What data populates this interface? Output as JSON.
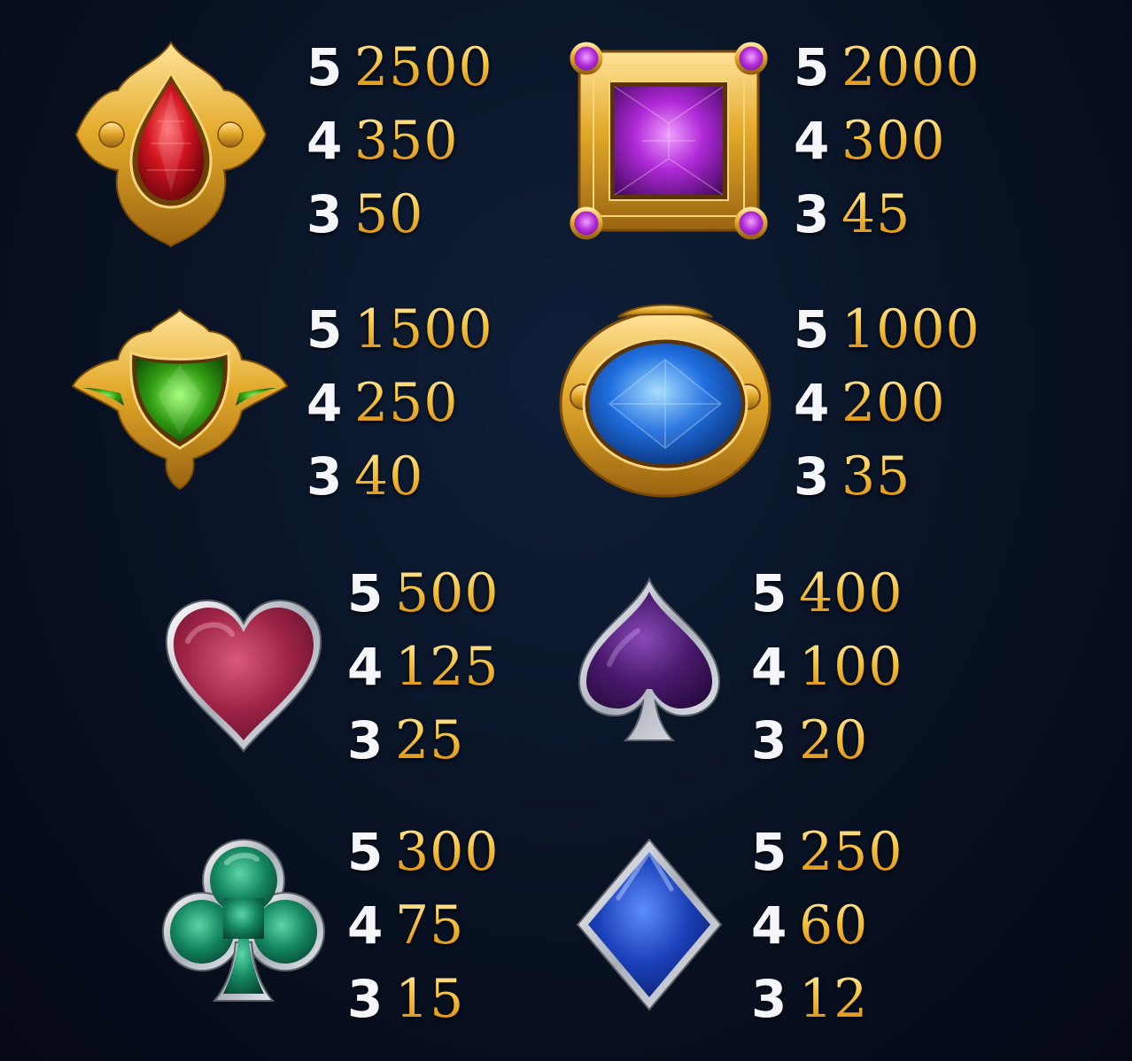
{
  "paytable": {
    "symbols": [
      {
        "name": "red-gem",
        "icon": "red-teardrop-gem-icon",
        "payouts": [
          {
            "count": "5",
            "amount": "2500"
          },
          {
            "count": "4",
            "amount": "350"
          },
          {
            "count": "3",
            "amount": "50"
          }
        ]
      },
      {
        "name": "purple-gem",
        "icon": "purple-square-gem-icon",
        "payouts": [
          {
            "count": "5",
            "amount": "2000"
          },
          {
            "count": "4",
            "amount": "300"
          },
          {
            "count": "3",
            "amount": "45"
          }
        ]
      },
      {
        "name": "green-gem",
        "icon": "green-crest-gem-icon",
        "payouts": [
          {
            "count": "5",
            "amount": "1500"
          },
          {
            "count": "4",
            "amount": "250"
          },
          {
            "count": "3",
            "amount": "40"
          }
        ]
      },
      {
        "name": "blue-gem",
        "icon": "blue-oval-gem-icon",
        "payouts": [
          {
            "count": "5",
            "amount": "1000"
          },
          {
            "count": "4",
            "amount": "200"
          },
          {
            "count": "3",
            "amount": "35"
          }
        ]
      },
      {
        "name": "heart",
        "icon": "heart-icon",
        "payouts": [
          {
            "count": "5",
            "amount": "500"
          },
          {
            "count": "4",
            "amount": "125"
          },
          {
            "count": "3",
            "amount": "25"
          }
        ]
      },
      {
        "name": "spade",
        "icon": "spade-icon",
        "payouts": [
          {
            "count": "5",
            "amount": "400"
          },
          {
            "count": "4",
            "amount": "100"
          },
          {
            "count": "3",
            "amount": "20"
          }
        ]
      },
      {
        "name": "club",
        "icon": "club-icon",
        "payouts": [
          {
            "count": "5",
            "amount": "300"
          },
          {
            "count": "4",
            "amount": "75"
          },
          {
            "count": "3",
            "amount": "15"
          }
        ]
      },
      {
        "name": "diamond",
        "icon": "diamond-icon",
        "payouts": [
          {
            "count": "5",
            "amount": "250"
          },
          {
            "count": "4",
            "amount": "60"
          },
          {
            "count": "3",
            "amount": "12"
          }
        ]
      }
    ]
  },
  "colors": {
    "background": "#0a1528",
    "count_text": "#f4f6fa",
    "amount_gold": "#f3b92c",
    "frame_gold": "#d9a21e"
  }
}
